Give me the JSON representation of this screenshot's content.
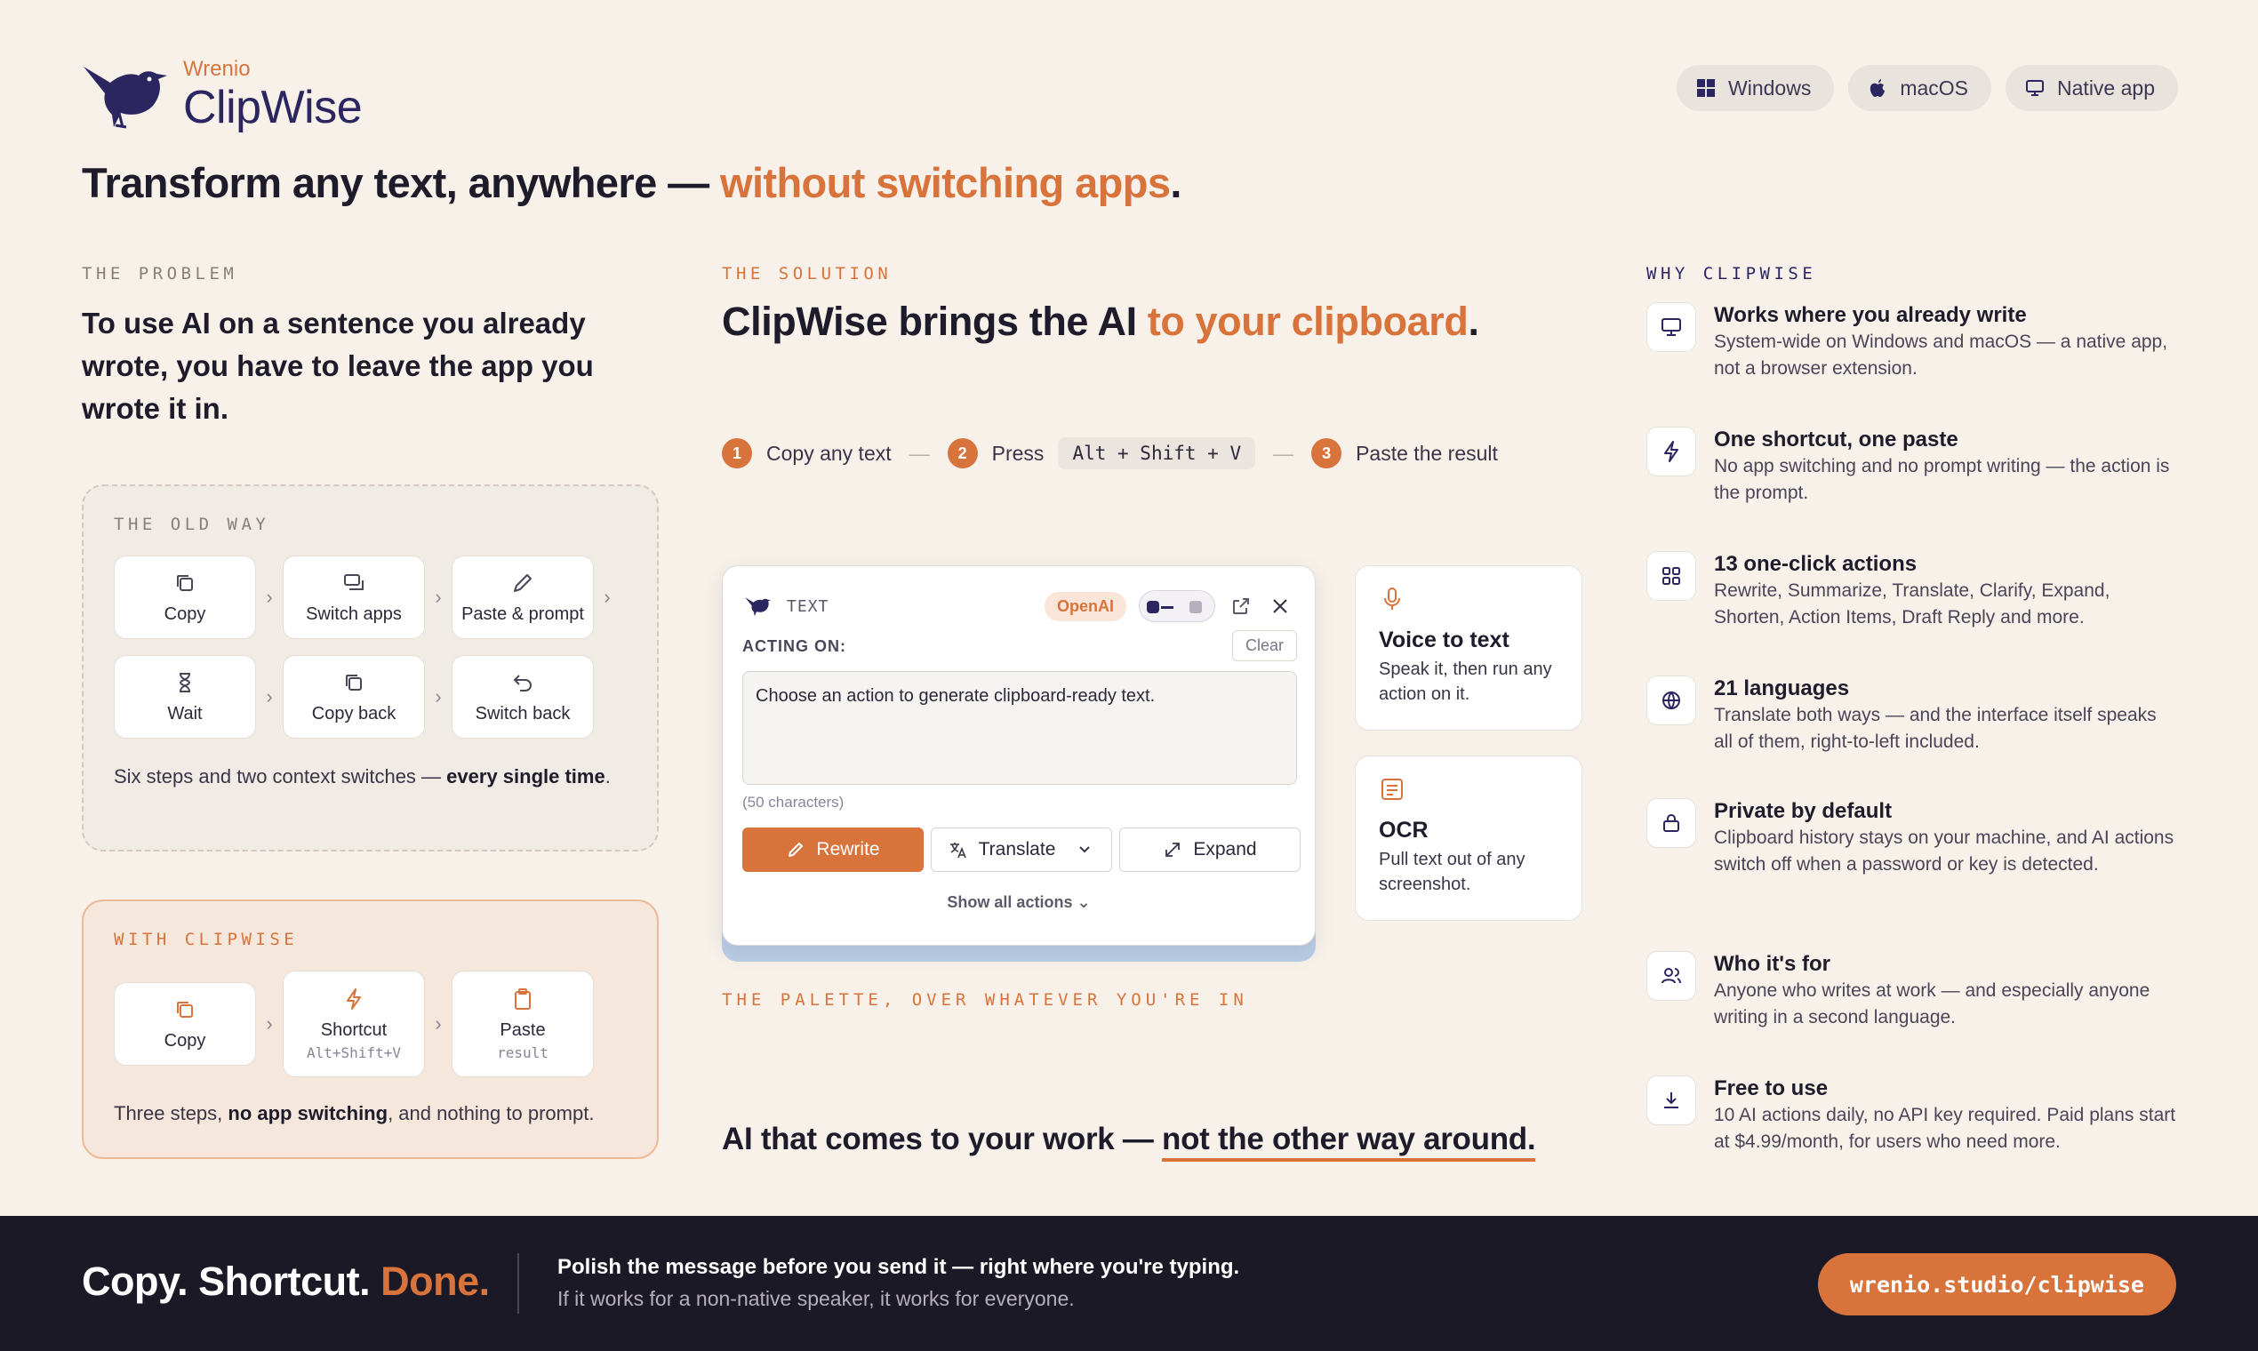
{
  "brand": {
    "company": "Wrenio",
    "product": "ClipWise"
  },
  "platforms": [
    "Windows",
    "macOS",
    "Native app"
  ],
  "headline": {
    "main": "Transform any text, anywhere — ",
    "accent": "without switching apps",
    "end": "."
  },
  "problem": {
    "eyebrow": "THE PROBLEM",
    "text": "To use AI on a sentence you already wrote, you have to leave the app you wrote it in.",
    "old_way": {
      "eyebrow": "THE OLD WAY",
      "steps": [
        "Copy",
        "Switch apps",
        "Paste & prompt",
        "Wait",
        "Copy back",
        "Switch back"
      ],
      "note_plain": "Six steps and two context switches — ",
      "note_bold": "every single time",
      "note_end": "."
    },
    "with_clipwise": {
      "eyebrow": "WITH CLIPWISE",
      "steps": [
        {
          "label": "Copy",
          "sub": ""
        },
        {
          "label": "Shortcut",
          "sub": "Alt+Shift+V"
        },
        {
          "label": "Paste",
          "sub": "result"
        }
      ],
      "note_a": "Three steps, ",
      "note_bold": "no app switching",
      "note_b": ", and nothing to prompt."
    }
  },
  "solution": {
    "eyebrow": "THE SOLUTION",
    "head_main": "ClipWise brings the AI ",
    "head_accent": "to your clipboard",
    "head_end": ".",
    "flow": [
      {
        "num": "1",
        "label": "Copy any text"
      },
      {
        "num": "2",
        "label": "Press",
        "kbd": "Alt + Shift + V"
      },
      {
        "num": "3",
        "label": "Paste the result"
      }
    ],
    "palette": {
      "title": "TEXT",
      "provider": "OpenAI",
      "acting_on": "ACTING ON:",
      "clear": "Clear",
      "text": "Choose an action to generate clipboard-ready text.",
      "chars": "(50 characters)",
      "actions": [
        "Rewrite",
        "Translate",
        "Expand"
      ],
      "show_all": "Show all actions"
    },
    "voice": {
      "title": "Voice to text",
      "desc": "Speak it, then run any action on it."
    },
    "ocr": {
      "title": "OCR",
      "desc": "Pull text out of any screenshot."
    },
    "palette_caption": "THE PALETTE, OVER WHATEVER YOU'RE IN",
    "tagline_main": "AI that comes to your work — ",
    "tagline_underline": "not the other way around."
  },
  "why": {
    "eyebrow": "WHY CLIPWISE",
    "features": [
      {
        "icon": "monitor-icon",
        "title": "Works where you already write",
        "desc": "System-wide on Windows and macOS — a native app, not a browser extension."
      },
      {
        "icon": "lightning-icon",
        "title": "One shortcut, one paste",
        "desc": "No app switching and no prompt writing — the action is the prompt."
      },
      {
        "icon": "grid-icon",
        "title": "13 one-click actions",
        "desc": "Rewrite, Summarize, Translate, Clarify, Expand, Shorten, Action Items, Draft Reply and more."
      },
      {
        "icon": "globe-icon",
        "title": "21 languages",
        "desc": "Translate both ways — and the interface itself speaks all of them, right-to-left included."
      },
      {
        "icon": "lock-icon",
        "title": "Private by default",
        "desc": "Clipboard history stays on your machine, and AI actions switch off when a password or key is detected."
      },
      {
        "icon": "users-icon",
        "title": "Who it's for",
        "desc": "Anyone who writes at work — and especially anyone writing in a second language."
      },
      {
        "icon": "download-icon",
        "title": "Free to use",
        "desc": "10 AI actions daily, no API key required. Paid plans start at $4.99/month, for users who need more."
      }
    ]
  },
  "footer": {
    "slogan_main": "Copy. Shortcut. ",
    "slogan_accent": "Done.",
    "line1": "Polish the message before you send it — right where you're typing.",
    "line2": "If it works for a non-native speaker, it works for everyone.",
    "cta": "wrenio.studio/clipwise"
  },
  "colors": {
    "accent": "#d8743b",
    "navy": "#2b2560",
    "background": "#f7f1ea",
    "footer": "#1c1927"
  }
}
